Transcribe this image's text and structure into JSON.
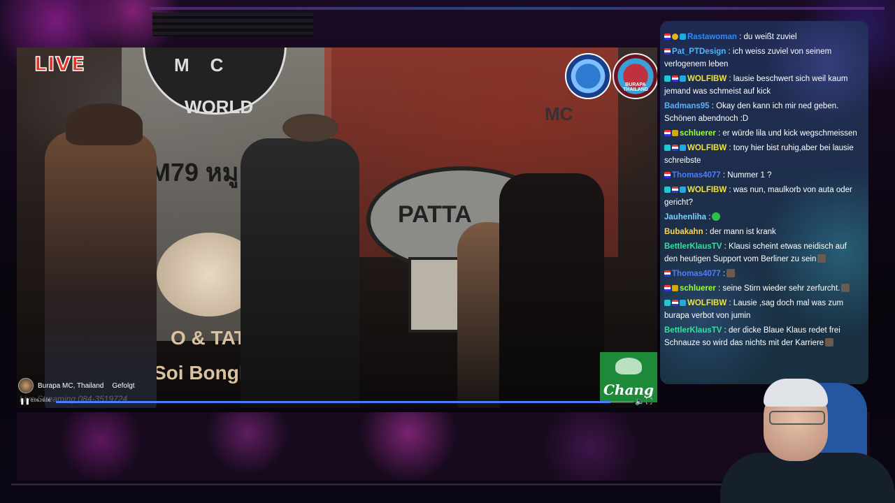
{
  "stream": {
    "live_label": "LIVE",
    "channel_name": "Burapa MC, Thailand",
    "follow_label": "Gefolgt",
    "watermark": "Live Streaming 084-3519724",
    "time_display": "0:06 / 0:06",
    "progress_fraction": 0.96,
    "sponsor_label": "Chang"
  },
  "scene_text": {
    "mc": "MC",
    "world": "WORLD",
    "m79": "M79 หมู",
    "tat": "O & TAT",
    "soi": "Soi Bongkot 8",
    "pattaya": "PATTA",
    "right_mc": "MC",
    "logo2": "BURAPA THAILAND"
  },
  "chat": {
    "messages": [
      {
        "badges": [
          "flag",
          "gold",
          "pixel"
        ],
        "user": "Rastawoman",
        "user_color": "#2b8cff",
        "text": ": du weißt zuviel",
        "emote": false
      },
      {
        "badges": [
          "flag"
        ],
        "user": "Pat_PTDesign",
        "user_color": "#4db8ff",
        "text": ": ich weiss zuviel von seinem verlogenem leben",
        "emote": false
      },
      {
        "badges": [
          "sub",
          "flag",
          "pixel"
        ],
        "user": "WOLFIBW",
        "user_color": "#f2e33a",
        "text": ": lausie beschwert sich weil kaum jemand was schmeist auf kick",
        "emote": false
      },
      {
        "badges": [],
        "user": "Badmans95",
        "user_color": "#5cb0ff",
        "text": ": Okay den kann ich mir ned geben. Schönen abendnoch :D",
        "emote": false
      },
      {
        "badges": [
          "flag",
          "crown"
        ],
        "user": "schluerer",
        "user_color": "#9dff3a",
        "text": ": er würde lila und kick wegschmeissen",
        "emote": false
      },
      {
        "badges": [
          "sub",
          "flag",
          "pixel"
        ],
        "user": "WOLFIBW",
        "user_color": "#f2e33a",
        "text": ": tony hier bist ruhig,aber bei lausie schreibste",
        "emote": false
      },
      {
        "badges": [
          "flag"
        ],
        "user": "Thomas4077",
        "user_color": "#4d7dff",
        "text": ": Nummer 1 ?",
        "emote": false
      },
      {
        "badges": [
          "sub",
          "flag",
          "pixel"
        ],
        "user": "WOLFIBW",
        "user_color": "#f2e33a",
        "text": ": was nun, maulkorb von auta oder gericht?",
        "emote": false
      },
      {
        "badges": [],
        "user": "Jauhenliha",
        "user_color": "#7fd0ff",
        "text": ":",
        "emote": "green"
      },
      {
        "badges": [],
        "user": "Bubakahn",
        "user_color": "#ffd54a",
        "text": ": der mann ist krank",
        "emote": false
      },
      {
        "badges": [],
        "user": "BettlerKlausTV",
        "user_color": "#34e0a0",
        "text": ": Klausi scheint etwas neidisch auf den heutigen Support vom Berliner zu sein",
        "emote": "brown"
      },
      {
        "badges": [
          "flag"
        ],
        "user": "Thomas4077",
        "user_color": "#4d7dff",
        "text": ":",
        "emote": "brown"
      },
      {
        "badges": [
          "flag",
          "crown"
        ],
        "user": "schluerer",
        "user_color": "#9dff3a",
        "text": ": seine Stirn wieder sehr zerfurcht.",
        "emote": "brown"
      },
      {
        "badges": [
          "sub",
          "flag",
          "pixel"
        ],
        "user": "WOLFIBW",
        "user_color": "#f2e33a",
        "text": ": Lausie ,sag doch mal was zum burapa verbot von jumin",
        "emote": false
      },
      {
        "badges": [],
        "user": "BettlerKlausTV",
        "user_color": "#34e0a0",
        "text": ": der dicke Blaue Klaus redet frei Schnauze so wird das nichts mit der Karriere",
        "emote": "brown"
      }
    ]
  }
}
